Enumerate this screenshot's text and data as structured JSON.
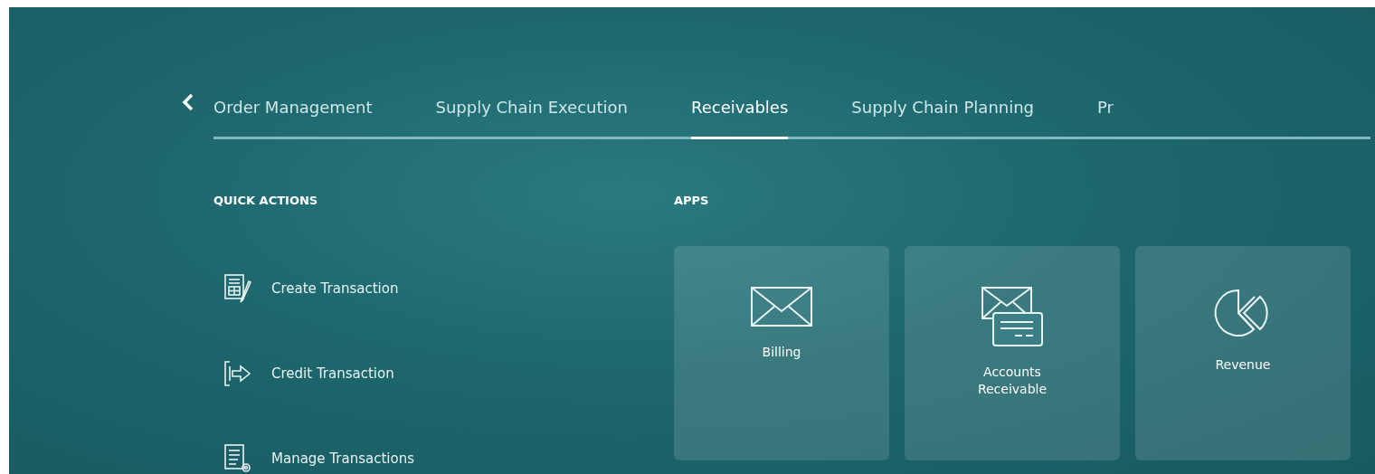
{
  "tabs": [
    {
      "label": "Order Management",
      "selected": false
    },
    {
      "label": "Supply Chain Execution",
      "selected": false
    },
    {
      "label": "Receivables",
      "selected": true
    },
    {
      "label": "Supply Chain Planning",
      "selected": false
    },
    {
      "label": "Pr",
      "selected": false
    }
  ],
  "quick_actions": {
    "heading": "QUICK ACTIONS",
    "items": [
      {
        "label": "Create Transaction",
        "kind": "create"
      },
      {
        "label": "Credit Transaction",
        "kind": "credit"
      },
      {
        "label": "Manage Transactions",
        "kind": "manage"
      }
    ]
  },
  "apps": {
    "heading": "APPS",
    "items": [
      {
        "label": "Billing",
        "kind": "billing"
      },
      {
        "label": "Accounts Receivable",
        "kind": "receivable"
      },
      {
        "label": "Revenue",
        "kind": "revenue"
      }
    ]
  }
}
